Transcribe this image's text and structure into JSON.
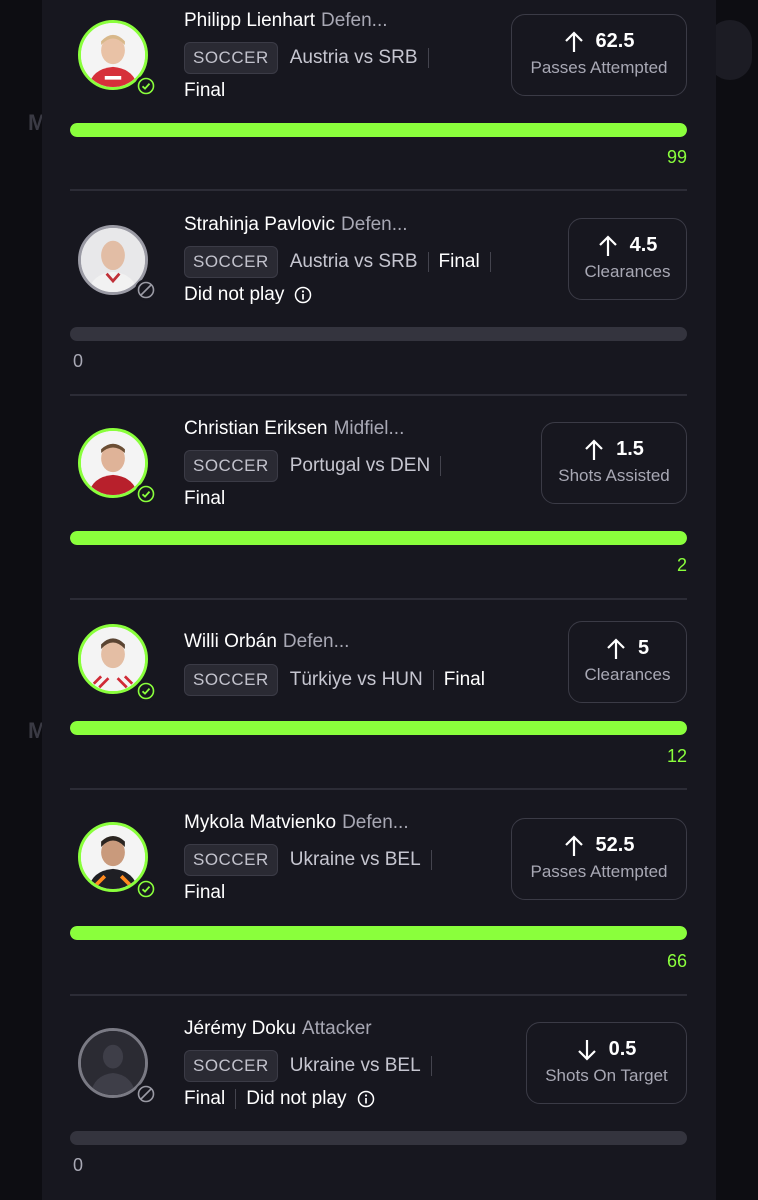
{
  "players": [
    {
      "name": "Philipp Lienhart",
      "position": "Defen...",
      "sport": "SOCCER",
      "matchup": "Austria vs SRB",
      "status": "Final",
      "dnp": "",
      "stat_value": "62.5",
      "stat_label": "Passes Attempted",
      "direction": "up",
      "progress": 1.0,
      "result": "99",
      "played": true
    },
    {
      "name": "Strahinja Pavlovic",
      "position": "Defen...",
      "sport": "SOCCER",
      "matchup": "Austria vs SRB",
      "status": "Final",
      "dnp": "Did not play",
      "stat_value": "4.5",
      "stat_label": "Clearances",
      "direction": "up",
      "progress": 0,
      "result": "0",
      "played": false
    },
    {
      "name": "Christian Eriksen",
      "position": "Midfiel...",
      "sport": "SOCCER",
      "matchup": "Portugal vs DEN",
      "status": "Final",
      "dnp": "",
      "stat_value": "1.5",
      "stat_label": "Shots Assisted",
      "direction": "up",
      "progress": 1.0,
      "result": "2",
      "played": true
    },
    {
      "name": "Willi Orbán",
      "position": "Defen...",
      "sport": "SOCCER",
      "matchup": "Türkiye vs HUN",
      "status": "Final",
      "dnp": "",
      "stat_value": "5",
      "stat_label": "Clearances",
      "direction": "up",
      "progress": 1.0,
      "result": "12",
      "played": true
    },
    {
      "name": "Mykola Matvienko",
      "position": "Defen...",
      "sport": "SOCCER",
      "matchup": "Ukraine vs BEL",
      "status": "Final",
      "dnp": "",
      "stat_value": "52.5",
      "stat_label": "Passes Attempted",
      "direction": "up",
      "progress": 1.0,
      "result": "66",
      "played": true
    },
    {
      "name": "Jérémy Doku",
      "position": "Attacker",
      "sport": "SOCCER",
      "matchup": "Ukraine vs BEL",
      "status": "Final",
      "dnp": "Did not play",
      "stat_value": "0.5",
      "stat_label": "Shots On Target",
      "direction": "down",
      "progress": 0,
      "result": "0",
      "played": false
    }
  ],
  "colors": {
    "accent": "#8aff3c",
    "sheet": "#17171f",
    "muted": "#a8a8b4"
  }
}
